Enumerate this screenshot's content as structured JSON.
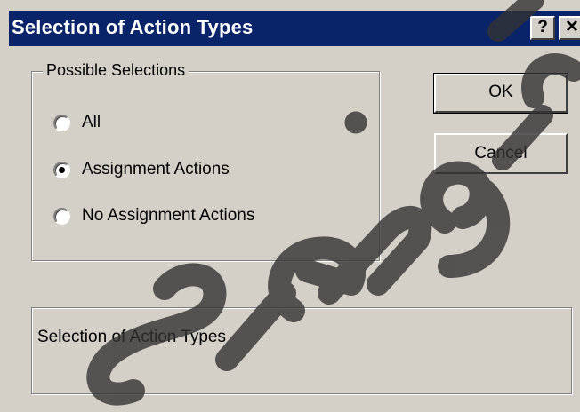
{
  "window": {
    "title": "Selection of Action Types",
    "help_glyph": "?",
    "close_glyph": "✕"
  },
  "group": {
    "legend": "Possible Selections",
    "options": [
      {
        "label": "All",
        "checked": false
      },
      {
        "label": "Assignment Actions",
        "checked": true
      },
      {
        "label": "No Assignment Actions",
        "checked": false
      }
    ]
  },
  "buttons": {
    "ok_label": "OK",
    "cancel_label": "Cancel"
  },
  "description": {
    "text": "Selection of Action Types"
  },
  "colors": {
    "titlebar": "#0a246a",
    "dialog_face": "#d4d0c8",
    "watermark": "#333333"
  }
}
